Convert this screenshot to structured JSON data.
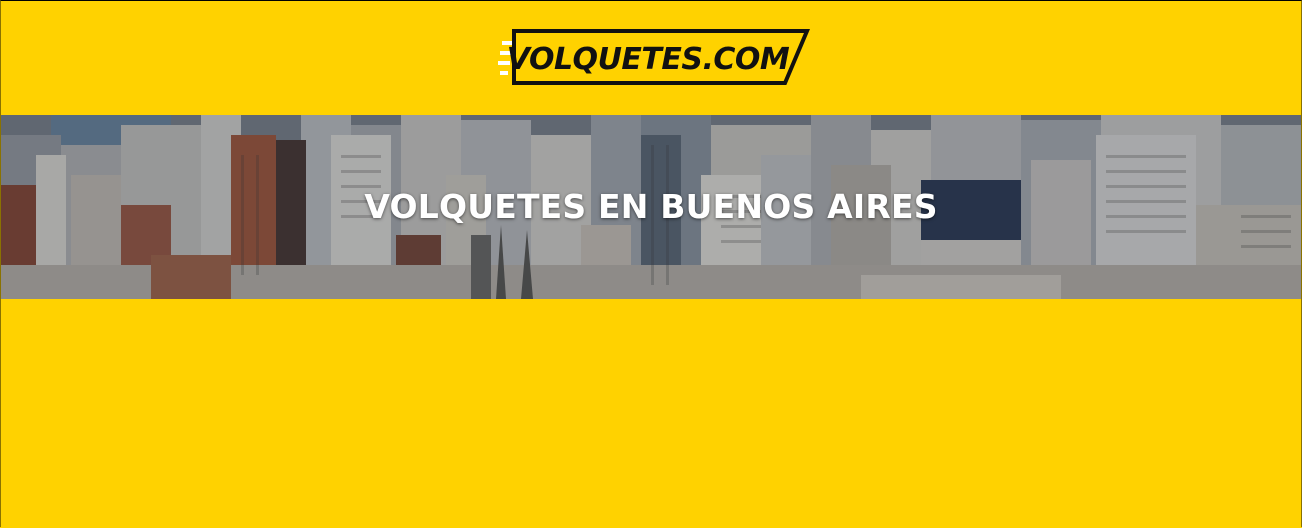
{
  "brand": {
    "logo_text": "VOLQUETES.COM",
    "primary_color": "#FFD200",
    "ink_color": "#111111"
  },
  "hero": {
    "title": "VOLQUETES EN BUENOS AIRES",
    "background_image": "city-skyline-photo"
  }
}
